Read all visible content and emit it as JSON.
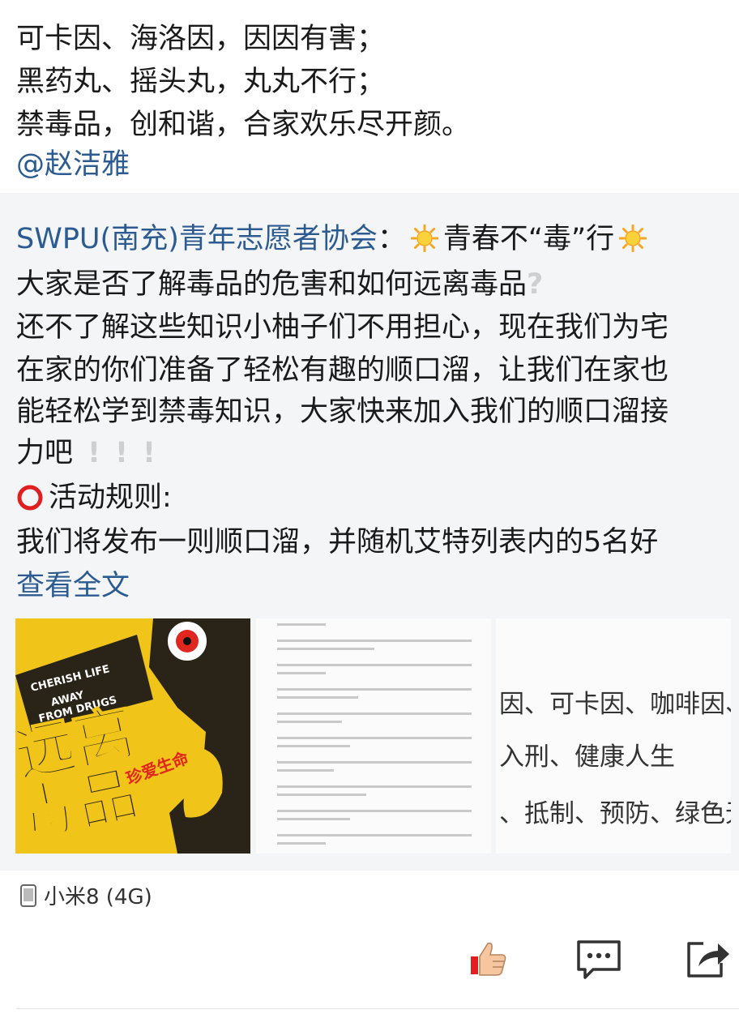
{
  "original_post": {
    "lines": [
      "可卡因、海洛因，因因有害；",
      "黑药丸、摇头丸，丸丸不行；",
      "禁毒品，创和谐，合家欢乐尽开颜。"
    ],
    "mention": "@赵洁雅"
  },
  "repost": {
    "author": "SWPU(南充)青年志愿者协会",
    "colon": "：",
    "title": "青春不“毒”行",
    "question_line": "大家是否了解毒品的危害和如何远离毒品",
    "question_mark": "?",
    "body_lines": [
      "还不了解这些知识小柚子们不用担心，现在我们为宅",
      "在家的你们准备了轻松有趣的顺口溜，让我们在家也",
      "能轻松学到禁毒知识，大家快来加入我们的顺口溜接"
    ],
    "body_last": "力吧",
    "exclamations": [
      "!",
      "!",
      "!"
    ],
    "rules_label": "活动规则:",
    "rules_text": "我们将发布一则顺口溜，并随机艾特列表内的5名好",
    "read_more": "查看全文"
  },
  "images": {
    "poster": {
      "slogan_lines": [
        "CHERISH LIFE",
        "AWAY",
        "FROM DRUGS"
      ],
      "big_text_1": "远离",
      "big_text_2": "毒品",
      "sub_text": "珍爱生命"
    },
    "crop_lines": [
      "因、可卡因、咖啡因、",
      "入刑、健康人生",
      "、抵制、预防、绿色无"
    ]
  },
  "footer": {
    "device_icon": "phone-icon",
    "device": "小米8 (4G)",
    "like_icon": "thumbs-up-icon",
    "comment_icon": "comment-icon",
    "share_icon": "share-icon"
  },
  "colors": {
    "link": "#2c5b91",
    "repost_bg": "#f4f5f7",
    "poster_yellow": "#f0c419"
  }
}
